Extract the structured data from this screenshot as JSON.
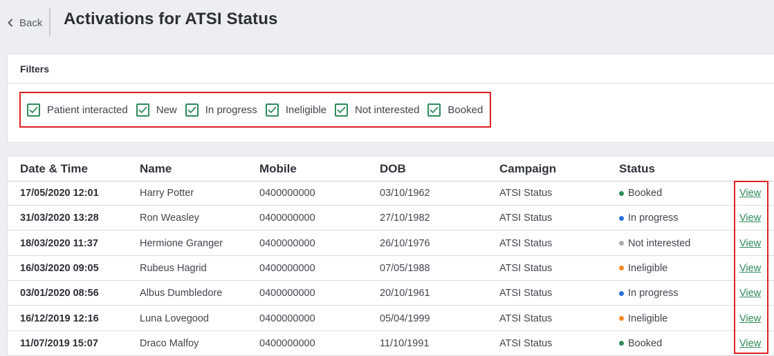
{
  "header": {
    "back_label": "Back",
    "title": "Activations for ATSI Status"
  },
  "filters": {
    "title": "Filters",
    "items": [
      {
        "label": "Patient interacted",
        "checked": true
      },
      {
        "label": "New",
        "checked": true
      },
      {
        "label": "In progress",
        "checked": true
      },
      {
        "label": "Ineligible",
        "checked": true
      },
      {
        "label": "Not interested",
        "checked": true
      },
      {
        "label": "Booked",
        "checked": true
      }
    ]
  },
  "table": {
    "columns": [
      "Date & Time",
      "Name",
      "Mobile",
      "DOB",
      "Campaign",
      "Status"
    ],
    "rows": [
      {
        "datetime": "17/05/2020 12:01",
        "name": "Harry Potter",
        "mobile": "0400000000",
        "dob": "03/10/1962",
        "campaign": "ATSI Status",
        "status": "Booked",
        "status_color": "#2f8a5a",
        "action": "View"
      },
      {
        "datetime": "31/03/2020 13:28",
        "name": "Ron Weasley",
        "mobile": "0400000000",
        "dob": "27/10/1982",
        "campaign": "ATSI Status",
        "status": "In progress",
        "status_color": "#2a6fd6",
        "action": "View"
      },
      {
        "datetime": "18/03/2020 11:37",
        "name": "Hermione Granger",
        "mobile": "0400000000",
        "dob": "26/10/1976",
        "campaign": "ATSI Status",
        "status": "Not interested",
        "status_color": "#a9acb1",
        "action": "View"
      },
      {
        "datetime": "16/03/2020 09:05",
        "name": "Rubeus Hagrid",
        "mobile": "0400000000",
        "dob": "07/05/1988",
        "campaign": "ATSI Status",
        "status": "Ineligible",
        "status_color": "#f08a24",
        "action": "View"
      },
      {
        "datetime": "03/01/2020 08:56",
        "name": "Albus Dumbledore",
        "mobile": "0400000000",
        "dob": "20/10/1961",
        "campaign": "ATSI Status",
        "status": "In progress",
        "status_color": "#2a6fd6",
        "action": "View"
      },
      {
        "datetime": "16/12/2019 12:16",
        "name": "Luna Lovegood",
        "mobile": "0400000000",
        "dob": "05/04/1999",
        "campaign": "ATSI Status",
        "status": "Ineligible",
        "status_color": "#f08a24",
        "action": "View"
      },
      {
        "datetime": "11/07/2019 15:07",
        "name": "Draco Malfoy",
        "mobile": "0400000000",
        "dob": "11/10/1991",
        "campaign": "ATSI Status",
        "status": "Booked",
        "status_color": "#2f8a5a",
        "action": "View"
      }
    ]
  },
  "colors": {
    "accent": "#2f8a5a",
    "highlight": "#e01f1f"
  },
  "icons": {
    "back": "chevron-left-icon",
    "check": "check-icon"
  }
}
